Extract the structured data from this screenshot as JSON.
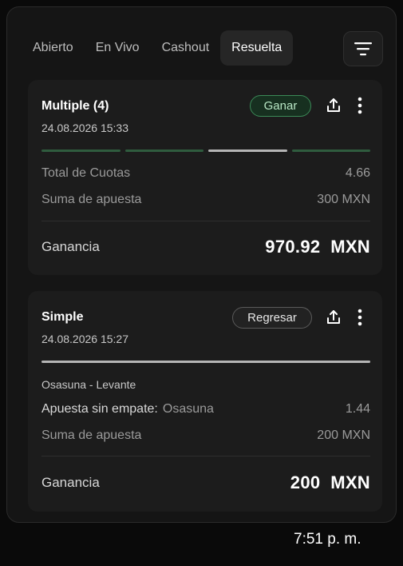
{
  "tabs": [
    {
      "label": "Abierto"
    },
    {
      "label": "En Vivo"
    },
    {
      "label": "Cashout"
    },
    {
      "label": "Resuelta"
    }
  ],
  "active_tab": "Resuelta",
  "colors": {
    "background": "#0b0b0b",
    "panel": "#151515",
    "card": "#1c1c1c",
    "win_green": "#3b8a57",
    "progress_green": "#2f5c3e",
    "progress_active": "#b5b5b5"
  },
  "bets": [
    {
      "title": "Multiple (4)",
      "date": "24.08.2026 15:33",
      "status": "Ganar",
      "legs_total": 4,
      "legs_highlighted": 3,
      "total_odds_label": "Total de Cuotas",
      "total_odds_value": "4.66",
      "stake_label": "Suma de apuesta",
      "stake_value": "300 MXN",
      "gain_label": "Ganancia",
      "gain_value": "970.92  MXN"
    },
    {
      "title": "Simple",
      "date": "24.08.2026 15:27",
      "status": "Regresar",
      "match": "Osasuna - Levante",
      "market_label": "Apuesta sin empate:",
      "pick": "Osasuna",
      "odds": "1.44",
      "stake_label": "Suma de apuesta",
      "stake_value": "200 MXN",
      "gain_label": "Ganancia",
      "gain_value": "200  MXN"
    }
  ],
  "icons": {
    "filter": "filter-lines-icon",
    "share": "share-icon",
    "more": "more-vertical-icon"
  },
  "status_bar": {
    "time": "7:51 p. m."
  }
}
